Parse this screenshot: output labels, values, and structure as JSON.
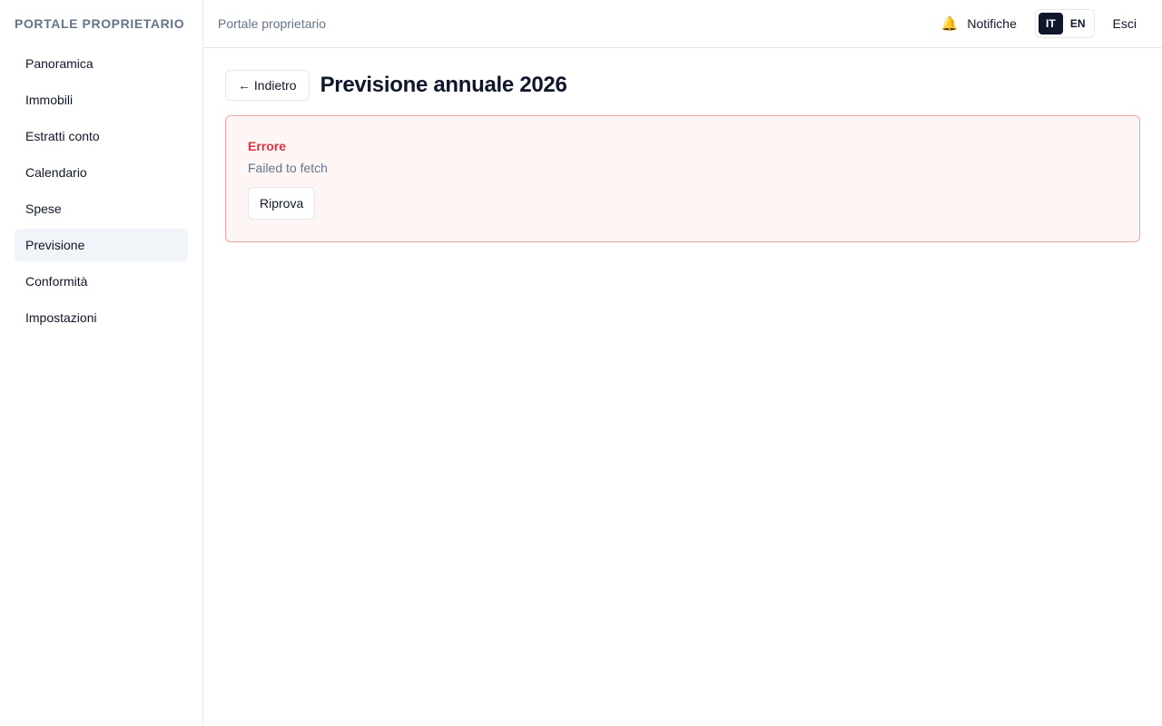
{
  "sidebar": {
    "brand": "PORTALE PROPRIETARIO",
    "items": [
      {
        "label": "Panoramica"
      },
      {
        "label": "Immobili"
      },
      {
        "label": "Estratti conto"
      },
      {
        "label": "Calendario"
      },
      {
        "label": "Spese"
      },
      {
        "label": "Previsione",
        "active": true
      },
      {
        "label": "Conformità"
      },
      {
        "label": "Impostazioni"
      }
    ]
  },
  "topbar": {
    "title": "Portale proprietario",
    "notifications_label": "Notifiche",
    "bell_icon": "bell-icon",
    "languages": [
      {
        "label": "IT",
        "active": true
      },
      {
        "label": "EN",
        "active": false
      }
    ],
    "logout_label": "Esci"
  },
  "main": {
    "back_label": "← Indietro",
    "page_title": "Previsione annuale 2026",
    "error": {
      "title": "Errore",
      "message": "Failed to fetch",
      "retry_label": "Riprova"
    }
  },
  "colors": {
    "error_red": "#dc3545",
    "error_bg": "#fef5f5",
    "active_nav_bg": "#f1f5f9",
    "active_lang_bg": "#0f172a"
  }
}
